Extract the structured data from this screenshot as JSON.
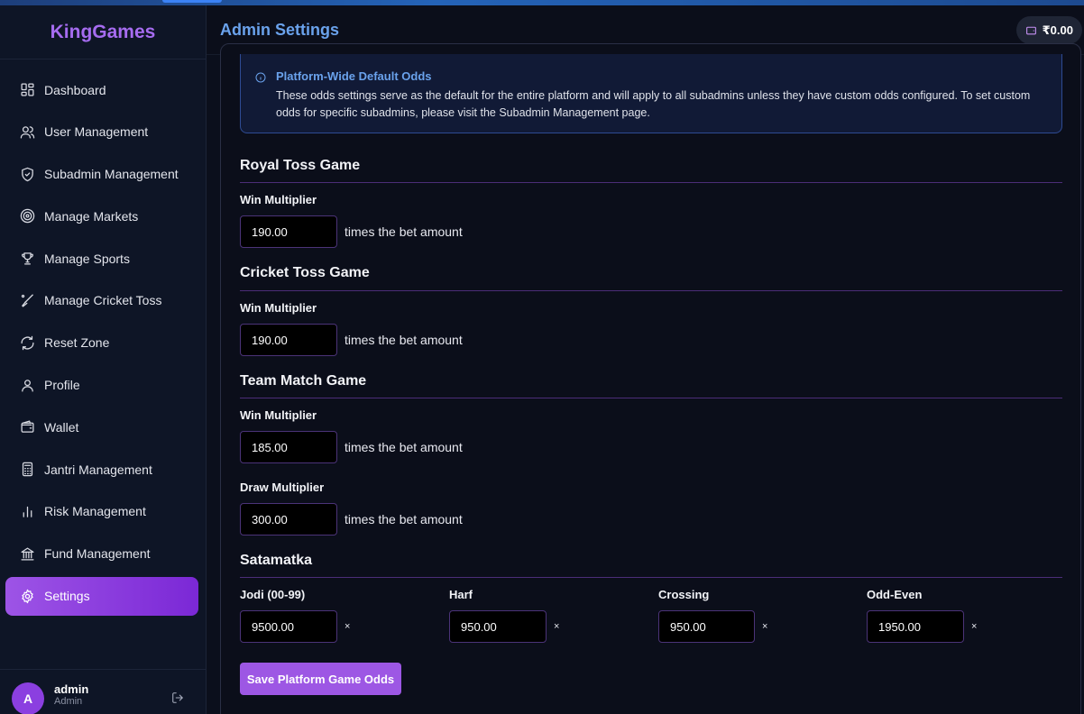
{
  "brand": "KingGames",
  "header": {
    "title": "Admin Settings",
    "balance": "₹0.00"
  },
  "sidebar": {
    "items": [
      {
        "label": "Dashboard",
        "icon": "dashboard-icon"
      },
      {
        "label": "User Management",
        "icon": "users-icon"
      },
      {
        "label": "Subadmin Management",
        "icon": "shield-icon"
      },
      {
        "label": "Manage Markets",
        "icon": "target-icon"
      },
      {
        "label": "Manage Sports",
        "icon": "trophy-icon"
      },
      {
        "label": "Manage Cricket Toss",
        "icon": "cricket-bat-icon"
      },
      {
        "label": "Reset Zone",
        "icon": "refresh-icon"
      },
      {
        "label": "Profile",
        "icon": "user-icon"
      },
      {
        "label": "Wallet",
        "icon": "wallet-icon"
      },
      {
        "label": "Jantri Management",
        "icon": "calculator-icon"
      },
      {
        "label": "Risk Management",
        "icon": "bar-chart-icon"
      },
      {
        "label": "Fund Management",
        "icon": "bank-icon"
      },
      {
        "label": "Settings",
        "icon": "gear-icon",
        "active": true
      }
    ],
    "user": {
      "initial": "A",
      "name": "admin",
      "role": "Admin"
    }
  },
  "info": {
    "title": "Platform-Wide Default Odds",
    "text": "These odds settings serve as the default for the entire platform and will apply to all subadmins unless they have custom odds configured. To set custom odds for specific subadmins, please visit the Subadmin Management page."
  },
  "suffix_text": "times the bet amount",
  "royal_toss": {
    "title": "Royal Toss Game",
    "win_label": "Win Multiplier",
    "win_value": "190.00"
  },
  "cricket_toss": {
    "title": "Cricket Toss Game",
    "win_label": "Win Multiplier",
    "win_value": "190.00"
  },
  "team_match": {
    "title": "Team Match Game",
    "win_label": "Win Multiplier",
    "win_value": "185.00",
    "draw_label": "Draw Multiplier",
    "draw_value": "300.00"
  },
  "satamatka": {
    "title": "Satamatka",
    "fields": [
      {
        "label": "Jodi (00-99)",
        "value": "9500.00"
      },
      {
        "label": "Harf",
        "value": "950.00"
      },
      {
        "label": "Crossing",
        "value": "950.00"
      },
      {
        "label": "Odd-Even",
        "value": "1950.00"
      }
    ],
    "multiplier_symbol": "×"
  },
  "save_label": "Save Platform Game Odds",
  "colors": {
    "accent": "#9d57e4",
    "title_blue": "#6aa2ec",
    "brand": "#a66cf0"
  }
}
